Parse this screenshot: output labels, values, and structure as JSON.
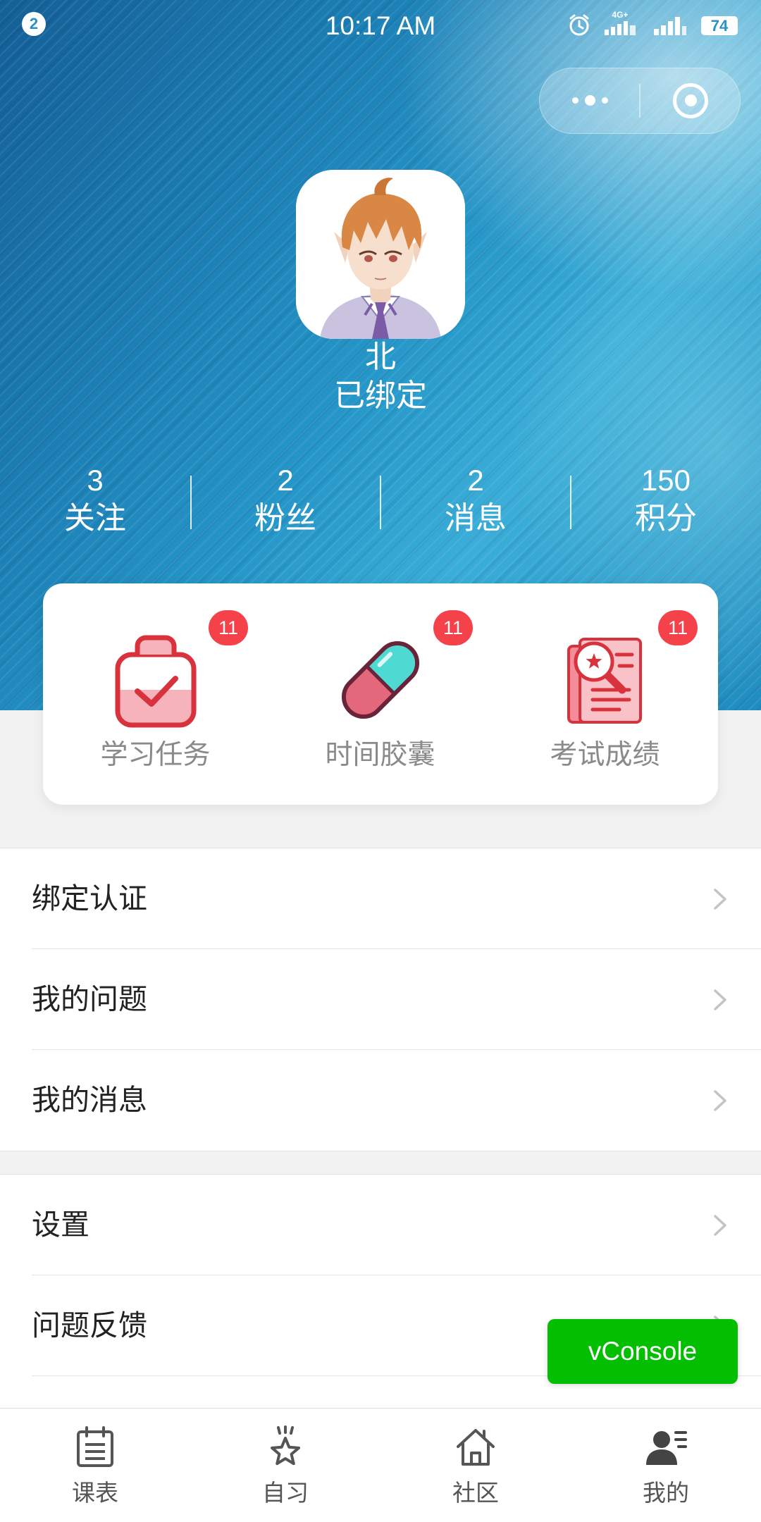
{
  "status_bar": {
    "notification_count": "2",
    "time": "10:17 AM",
    "network_type": "4G+",
    "battery_level": "74"
  },
  "capsule": {
    "more_icon": "more-dots-icon",
    "close_icon": "target-circle-icon"
  },
  "profile": {
    "avatar_icon": "anime-avatar-illustration",
    "name": "北",
    "bind_status": "已绑定"
  },
  "stats": [
    {
      "value": "3",
      "label": "关注"
    },
    {
      "value": "2",
      "label": "粉丝"
    },
    {
      "value": "2",
      "label": "消息"
    },
    {
      "value": "150",
      "label": "积分"
    }
  ],
  "quick_actions": [
    {
      "label": "学习任务",
      "badge": "11",
      "icon": "clipboard-check-icon"
    },
    {
      "label": "时间胶囊",
      "badge": "11",
      "icon": "capsule-pill-icon"
    },
    {
      "label": "考试成绩",
      "badge": "11",
      "icon": "report-search-icon"
    }
  ],
  "menu_group_1": [
    {
      "label": "绑定认证"
    },
    {
      "label": "我的问题"
    },
    {
      "label": "我的消息"
    }
  ],
  "menu_group_2": [
    {
      "label": "设置"
    },
    {
      "label": "问题反馈"
    }
  ],
  "vconsole": {
    "label": "vConsole"
  },
  "tab_bar": {
    "active_index": 3,
    "items": [
      {
        "label": "课表",
        "icon": "schedule-icon"
      },
      {
        "label": "自习",
        "icon": "study-star-icon"
      },
      {
        "label": "社区",
        "icon": "community-home-icon"
      },
      {
        "label": "我的",
        "icon": "profile-user-icon"
      }
    ]
  },
  "colors": {
    "header_blue": "#2596c8",
    "badge_red": "#f5414a",
    "vconsole_green": "#04be02",
    "page_background": "#f2f2f2"
  }
}
